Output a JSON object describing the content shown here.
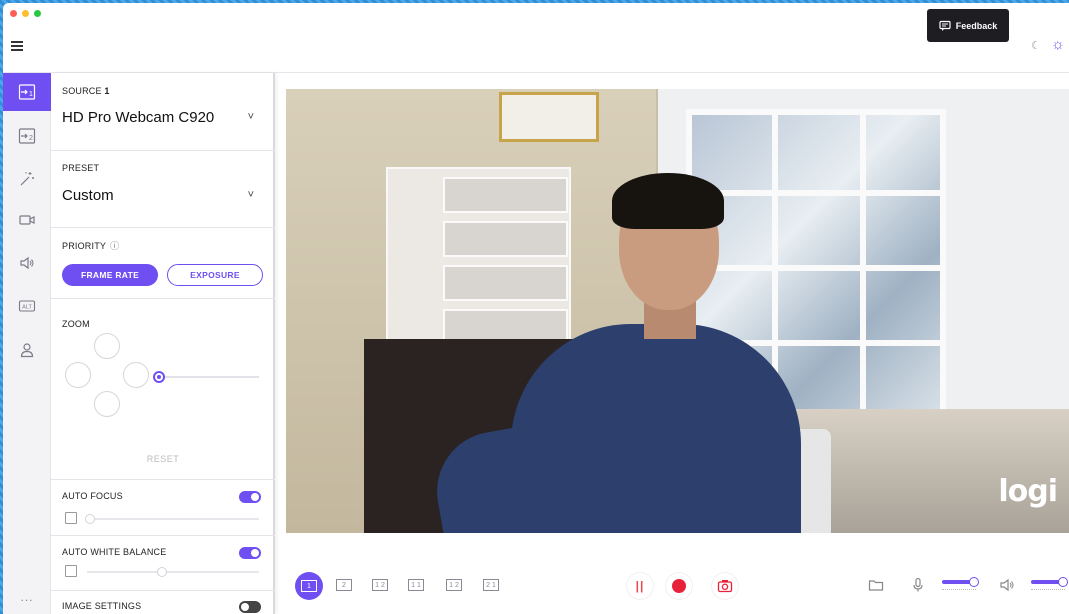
{
  "header": {
    "feedback_label": "Feedback"
  },
  "sidebar": {
    "items": [
      {
        "name": "source-1",
        "icon": "source-1-icon"
      },
      {
        "name": "source-2",
        "icon": "source-2-icon"
      },
      {
        "name": "effects",
        "icon": "magic-wand-icon"
      },
      {
        "name": "camera",
        "icon": "camera-icon"
      },
      {
        "name": "audio",
        "icon": "speaker-icon"
      },
      {
        "name": "alt",
        "icon": "alt-icon",
        "label": "ALT"
      },
      {
        "name": "account",
        "icon": "user-icon"
      }
    ],
    "more_label": "..."
  },
  "panel": {
    "source": {
      "label_prefix": "SOURCE",
      "label_number": "1",
      "value": "HD Pro Webcam C920"
    },
    "preset": {
      "label": "PRESET",
      "value": "Custom"
    },
    "priority": {
      "label": "PRIORITY",
      "frame_rate": "FRAME RATE",
      "exposure": "EXPOSURE",
      "selected": "FRAME RATE"
    },
    "zoom": {
      "label": "ZOOM",
      "reset": "RESET",
      "level": 0
    },
    "auto_focus": {
      "label": "AUTO FOCUS",
      "enabled": true
    },
    "auto_white_balance": {
      "label": "AUTO WHITE BALANCE",
      "enabled": true
    },
    "image_settings": {
      "label": "IMAGE SETTINGS",
      "enabled": false
    }
  },
  "preview": {
    "watermark": "logi"
  },
  "bottombar": {
    "layouts": [
      "1",
      "2",
      "1 2",
      "1 1",
      "1 2",
      "2 1"
    ],
    "active_layout": 0
  },
  "colors": {
    "accent": "#6f4ff2",
    "record": "#e8213a"
  }
}
